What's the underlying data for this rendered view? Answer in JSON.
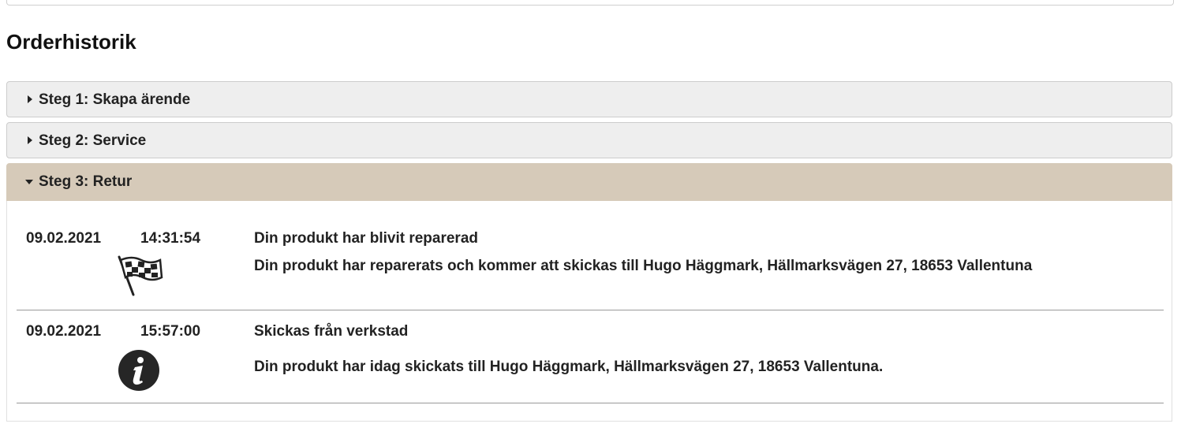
{
  "heading": "Orderhistorik",
  "steps": [
    {
      "label": "Steg 1: Skapa ärende",
      "expanded": false
    },
    {
      "label": "Steg 2: Service",
      "expanded": false
    },
    {
      "label": "Steg 3: Retur",
      "expanded": true
    }
  ],
  "events": [
    {
      "date": "09.02.2021",
      "time": "14:31:54",
      "icon": "checkered-flag-icon",
      "title": "Din produkt har blivit reparerad",
      "description": "Din produkt har reparerats och kommer att skickas till Hugo Häggmark, Hällmarksvägen 27, 18653 Vallentuna"
    },
    {
      "date": "09.02.2021",
      "time": "15:57:00",
      "icon": "info-icon",
      "title": "Skickas från verkstad",
      "description": "Din produkt har idag skickats till Hugo Häggmark, Hällmarksvägen 27, 18653 Vallentuna."
    }
  ],
  "colors": {
    "collapsed_header_bg": "#eeeeee",
    "expanded_header_bg": "#d6cab9",
    "text": "#222222"
  }
}
